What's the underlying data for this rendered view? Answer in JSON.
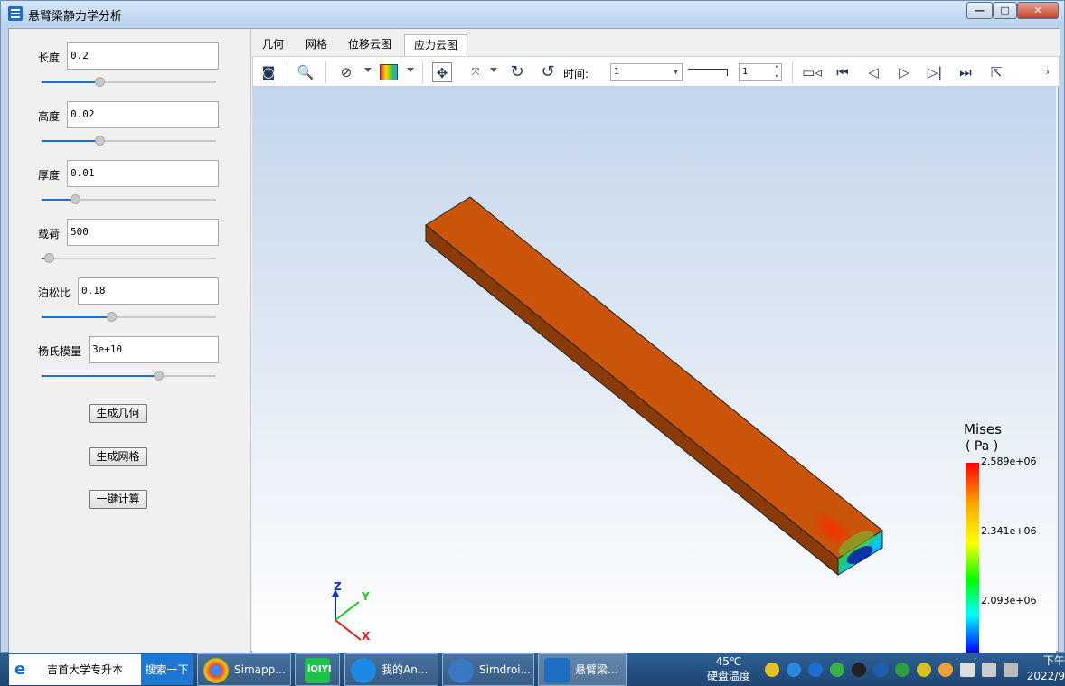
{
  "window": {
    "title": "悬臂梁静力学分析",
    "controls": {
      "minimize": "—",
      "maximize": "□",
      "close": "✕"
    }
  },
  "params": [
    {
      "label": "长度",
      "value": "0.2",
      "slider_fraction": 0.33
    },
    {
      "label": "高度",
      "value": "0.02",
      "slider_fraction": 0.33
    },
    {
      "label": "厚度",
      "value": "0.01",
      "slider_fraction": 0.19
    },
    {
      "label": "载荷",
      "value": "500",
      "slider_fraction": 0.04
    },
    {
      "label": "泊松比",
      "value": "0.18",
      "slider_fraction": 0.4
    },
    {
      "label": "杨氏模量",
      "value": "3e+10",
      "slider_fraction": 0.67
    }
  ],
  "buttons": {
    "geometry": "生成几何",
    "mesh": "生成网格",
    "compute": "一键计算"
  },
  "tabs": [
    {
      "label": "几何",
      "active": false
    },
    {
      "label": "网格",
      "active": false
    },
    {
      "label": "位移云图",
      "active": false
    },
    {
      "label": "应力云图",
      "active": true
    }
  ],
  "toolbar": {
    "time_label": "时间:",
    "time_value": "1",
    "step_value": "1",
    "icons": [
      "camera-icon",
      "zoom-icon",
      "section-icon",
      "colormap-icon",
      "fit-view-icon",
      "axes-icon",
      "rotate-cw-icon",
      "rotate-ccw-icon",
      "record-icon",
      "first-frame-icon",
      "prev-frame-icon",
      "play-icon",
      "next-frame-icon",
      "last-frame-icon",
      "export-icon"
    ]
  },
  "legend": {
    "title": "Mises",
    "unit": "( Pa )",
    "ticks": [
      "2.589e+06",
      "2.341e+06",
      "2.093e+06"
    ],
    "colors": [
      "#ff0000",
      "#ffaa00",
      "#ffff00",
      "#00ff00",
      "#00ffff",
      "#0000ff"
    ]
  },
  "axes": {
    "z": "Z",
    "y": "Y",
    "x": "X"
  },
  "beam": {
    "top_color": "#c9540a",
    "side_color": "#8a3a06",
    "end_color": "#5a2404"
  },
  "taskbar": {
    "search_text": "吉首大学专升本",
    "search_button": "搜索一下",
    "apps": [
      {
        "label": "Simapp...",
        "color": "#4caf50"
      },
      {
        "label": "iQIYI",
        "color": "#1ec24a"
      },
      {
        "label": "我的An...",
        "color": "#1e88e5"
      },
      {
        "label": "Simdroi...",
        "color": "#3a78c4"
      },
      {
        "label": "悬臂梁...",
        "color": "#1e6fc4"
      }
    ],
    "temp_value": "45℃",
    "temp_label": "硬盘温度",
    "clock_time": "下午",
    "clock_date": "2022/9"
  }
}
